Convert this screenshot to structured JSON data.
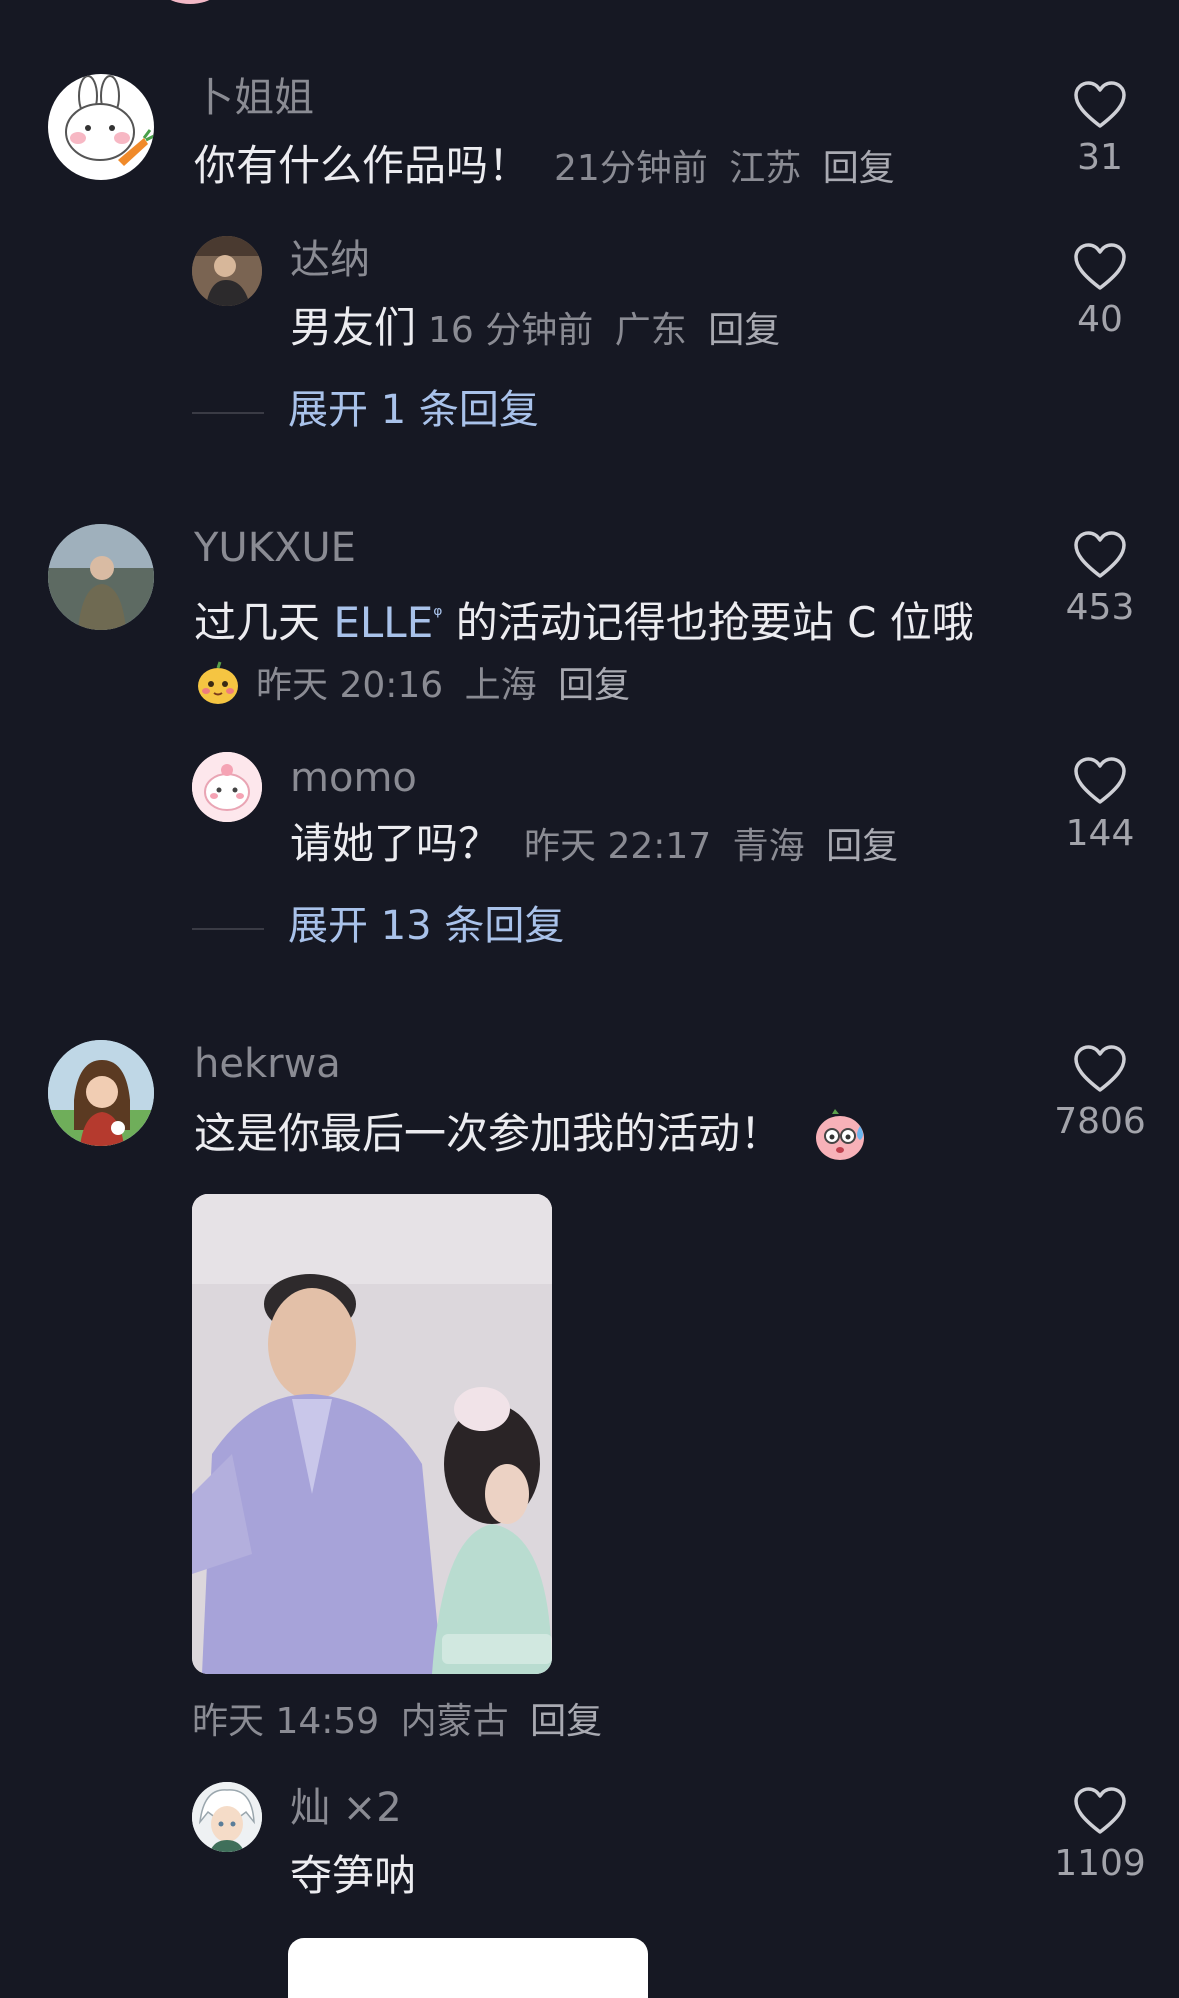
{
  "comments": [
    {
      "username": "卜姐姐",
      "text": "你有什么作品吗！",
      "time": "21分钟前",
      "location": "江苏",
      "reply_label": "回复",
      "likes": "31",
      "avatar_icon": "bunny-carrot-avatar",
      "replies": [
        {
          "username": "达纳",
          "text": "男友们",
          "time": "16 分钟前",
          "location": "广东",
          "reply_label": "回复",
          "likes": "40",
          "avatar_icon": "man-photo-avatar"
        }
      ],
      "expand_label": "展开 1 条回复"
    },
    {
      "username": "YUKXUE",
      "text_before": "过几天 ",
      "mention": "ELLE",
      "text_after": " 的活动记得也抢要站 C 位哦",
      "emoji_icon": "yellow-blush-sticker",
      "time": "昨天 20:16",
      "location": "上海",
      "reply_label": "回复",
      "likes": "453",
      "avatar_icon": "woman-photo-avatar",
      "replies": [
        {
          "username": "momo",
          "text": "请她了吗？",
          "time": "昨天 22:17",
          "location": "青海",
          "reply_label": "回复",
          "likes": "144",
          "avatar_icon": "pink-cartoon-avatar"
        }
      ],
      "expand_label": "展开 13 条回复"
    },
    {
      "username": "hekrwa",
      "text": "这是你最后一次参加我的活动！",
      "emoji_icon": "sweating-face-sticker",
      "time": "昨天 14:59",
      "location": "内蒙古",
      "reply_label": "回复",
      "likes": "7806",
      "avatar_icon": "illustrated-girl-avatar",
      "image_icon": "event-video-thumbnail",
      "replies": [
        {
          "username": "灿 ×2",
          "text": "夺笋呐",
          "likes": "1109",
          "avatar_icon": "anime-boy-avatar"
        }
      ]
    }
  ],
  "colors": {
    "background": "#161823",
    "username": "#8a8b93",
    "text": "#ececf0",
    "link": "#a9c2ea"
  }
}
